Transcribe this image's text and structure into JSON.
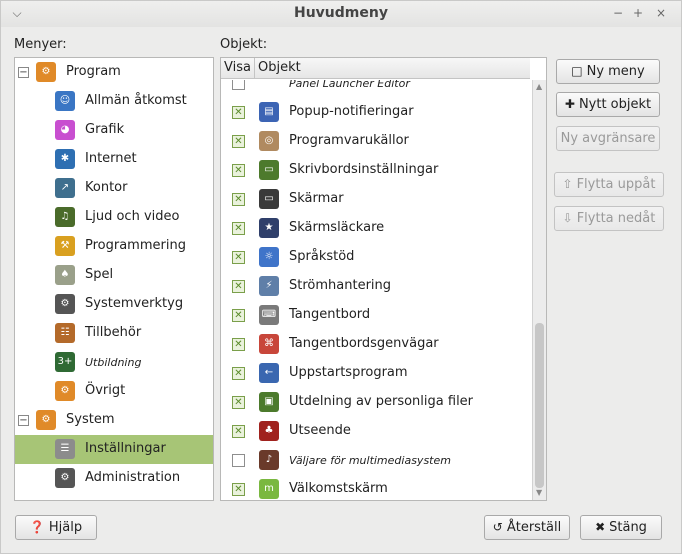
{
  "window": {
    "title": "Huvudmeny"
  },
  "labels": {
    "menus": "Menyer:",
    "items": "Objekt:"
  },
  "menus_tree": [
    {
      "label": "Program",
      "level": 0,
      "expander": "−",
      "icon_color": "#e08a28",
      "glyph": "⚙",
      "icon": "program-category-icon"
    },
    {
      "label": "Allmän åtkomst",
      "level": 1,
      "icon_color": "#3a76c4",
      "glyph": "☺",
      "icon": "accessibility-icon"
    },
    {
      "label": "Grafik",
      "level": 1,
      "icon_color": "#c84fd0",
      "glyph": "◕",
      "icon": "graphics-icon"
    },
    {
      "label": "Internet",
      "level": 1,
      "icon_color": "#2e6fb2",
      "glyph": "✱",
      "icon": "internet-icon"
    },
    {
      "label": "Kontor",
      "level": 1,
      "icon_color": "#3f6f8e",
      "glyph": "↗",
      "icon": "office-icon"
    },
    {
      "label": "Ljud och video",
      "level": 1,
      "icon_color": "#4a6b2a",
      "glyph": "♫",
      "icon": "sound-video-icon"
    },
    {
      "label": "Programmering",
      "level": 1,
      "icon_color": "#d9a020",
      "glyph": "⚒",
      "icon": "programming-icon"
    },
    {
      "label": "Spel",
      "level": 1,
      "icon_color": "#9aa08a",
      "glyph": "♠",
      "icon": "games-icon"
    },
    {
      "label": "Systemverktyg",
      "level": 1,
      "icon_color": "#555555",
      "glyph": "⚙",
      "icon": "system-tools-icon"
    },
    {
      "label": "Tillbehör",
      "level": 1,
      "icon_color": "#b46a2a",
      "glyph": "☷",
      "icon": "accessories-icon"
    },
    {
      "label": "Utbildning",
      "level": 1,
      "italic": true,
      "icon_color": "#2f6a34",
      "glyph": "3+",
      "icon": "education-icon"
    },
    {
      "label": "Övrigt",
      "level": 1,
      "icon_color": "#e08a28",
      "glyph": "⚙",
      "icon": "other-icon"
    },
    {
      "label": "System",
      "level": 0,
      "expander": "−",
      "icon_color": "#e08a28",
      "glyph": "⚙",
      "icon": "system-category-icon"
    },
    {
      "label": "Inställningar",
      "level": 1,
      "selected": true,
      "icon_color": "#8c8c8c",
      "glyph": "☰",
      "icon": "settings-icon"
    },
    {
      "label": "Administration",
      "level": 1,
      "icon_color": "#555555",
      "glyph": "⚙",
      "icon": "administration-icon"
    }
  ],
  "items_table": {
    "columns": {
      "show": "Visa",
      "item": "Objekt"
    },
    "partial_item": "Panel Launcher Editor",
    "rows": [
      {
        "label": "Popup-notifieringar",
        "checked": true,
        "icon_color": "#3c64b4",
        "glyph": "▤",
        "icon": "popup-notifications-icon"
      },
      {
        "label": "Programvarukällor",
        "checked": true,
        "icon_color": "#b08a60",
        "glyph": "◎",
        "icon": "software-sources-icon"
      },
      {
        "label": "Skrivbordsinställningar",
        "checked": true,
        "icon_color": "#4d7a2c",
        "glyph": "▭",
        "icon": "desktop-settings-icon"
      },
      {
        "label": "Skärmar",
        "checked": true,
        "icon_color": "#3a3a3a",
        "glyph": "▭",
        "icon": "displays-icon"
      },
      {
        "label": "Skärmsläckare",
        "checked": true,
        "icon_color": "#2f3f6a",
        "glyph": "★",
        "icon": "screensaver-icon"
      },
      {
        "label": "Språkstöd",
        "checked": true,
        "icon_color": "#3f74c9",
        "glyph": "☼",
        "icon": "language-support-icon"
      },
      {
        "label": "Strömhantering",
        "checked": true,
        "icon_color": "#5f7fa8",
        "glyph": "⚡",
        "icon": "power-management-icon"
      },
      {
        "label": "Tangentbord",
        "checked": true,
        "icon_color": "#7a7a7a",
        "glyph": "⌨",
        "icon": "keyboard-icon"
      },
      {
        "label": "Tangentbordsgenvägar",
        "checked": true,
        "icon_color": "#c8463a",
        "glyph": "⌘",
        "icon": "keyboard-shortcuts-icon"
      },
      {
        "label": "Uppstartsprogram",
        "checked": true,
        "icon_color": "#3a67b0",
        "glyph": "←",
        "icon": "startup-applications-icon"
      },
      {
        "label": "Utdelning av personliga filer",
        "checked": true,
        "icon_color": "#4c7a2c",
        "glyph": "▣",
        "icon": "file-sharing-icon"
      },
      {
        "label": "Utseende",
        "checked": true,
        "icon_color": "#a0221e",
        "glyph": "♣",
        "icon": "appearance-icon"
      },
      {
        "label": "Väljare för multimediasystem",
        "checked": false,
        "italic": true,
        "icon_color": "#6a3a2a",
        "glyph": "♪",
        "icon": "multimedia-selector-icon"
      },
      {
        "label": "Välkomstskärm",
        "checked": true,
        "icon_color": "#7ab840",
        "glyph": "m",
        "icon": "welcome-screen-icon"
      }
    ]
  },
  "buttons": {
    "new_menu": "Ny meny",
    "new_item": "Nytt objekt",
    "new_separator": "Ny avgränsare",
    "move_up": "Flytta uppåt",
    "move_down": "Flytta nedåt",
    "help": "Hjälp",
    "revert": "Återställ",
    "close": "Stäng"
  },
  "colors": {
    "selection": "#a7c576",
    "check_on": "#5a8b2a"
  }
}
